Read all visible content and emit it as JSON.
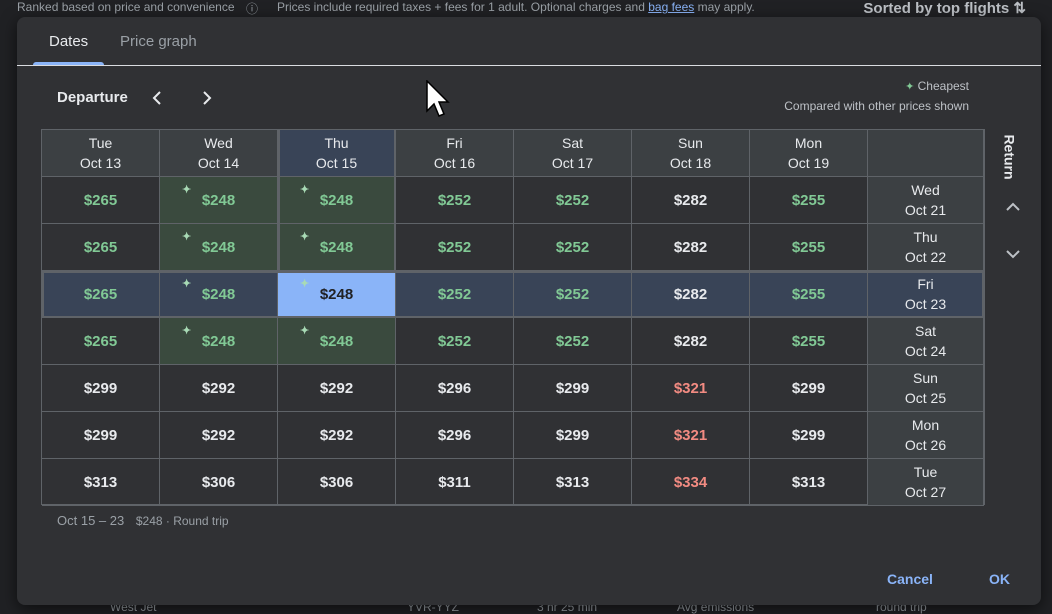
{
  "background": {
    "top_left": "Ranked based on price and convenience",
    "top_middle_prefix": "Prices include required taxes + fees for 1 adult. Optional charges and",
    "top_link": "bag fees",
    "top_middle_suffix": "may apply.",
    "top_right": "Sorted by top flights",
    "bottom_left": "West Jet",
    "bottom_mid": "YVR-YYZ",
    "bottom_mid2": "3 hr 25 min",
    "bottom_mid3": "Avg emissions",
    "bottom_right": "round trip"
  },
  "tabs": [
    {
      "label": "Dates",
      "active": true
    },
    {
      "label": "Price graph",
      "active": false
    }
  ],
  "departure_label": "Departure",
  "legend": {
    "cheapest": "Cheapest",
    "note": "Compared with other prices shown"
  },
  "return_label": "Return",
  "columns": [
    {
      "day": "Tue",
      "date": "Oct 13"
    },
    {
      "day": "Wed",
      "date": "Oct 14"
    },
    {
      "day": "Thu",
      "date": "Oct 15"
    },
    {
      "day": "Fri",
      "date": "Oct 16"
    },
    {
      "day": "Sat",
      "date": "Oct 17"
    },
    {
      "day": "Sun",
      "date": "Oct 18"
    },
    {
      "day": "Mon",
      "date": "Oct 19"
    }
  ],
  "rows": [
    {
      "day": "Wed",
      "date": "Oct 21",
      "prices": [
        "$265",
        "$248",
        "$248",
        "$252",
        "$252",
        "$282",
        "$255"
      ]
    },
    {
      "day": "Thu",
      "date": "Oct 22",
      "prices": [
        "$265",
        "$248",
        "$248",
        "$252",
        "$252",
        "$282",
        "$255"
      ]
    },
    {
      "day": "Fri",
      "date": "Oct 23",
      "prices": [
        "$265",
        "$248",
        "$248",
        "$252",
        "$252",
        "$282",
        "$255"
      ]
    },
    {
      "day": "Sat",
      "date": "Oct 24",
      "prices": [
        "$265",
        "$248",
        "$248",
        "$252",
        "$252",
        "$282",
        "$255"
      ]
    },
    {
      "day": "Sun",
      "date": "Oct 25",
      "prices": [
        "$299",
        "$292",
        "$292",
        "$296",
        "$299",
        "$321",
        "$299"
      ]
    },
    {
      "day": "Mon",
      "date": "Oct 26",
      "prices": [
        "$299",
        "$292",
        "$292",
        "$296",
        "$299",
        "$321",
        "$299"
      ]
    },
    {
      "day": "Tue",
      "date": "Oct 27",
      "prices": [
        "$313",
        "$306",
        "$306",
        "$311",
        "$313",
        "$334",
        "$313"
      ]
    }
  ],
  "price_status": [
    [
      "cheap",
      "cheap",
      "cheap",
      "cheap",
      "cheap",
      "normal",
      "cheap"
    ],
    [
      "cheap",
      "cheap",
      "cheap",
      "cheap",
      "cheap",
      "normal",
      "cheap"
    ],
    [
      "cheap",
      "cheap",
      "normal",
      "cheap",
      "cheap",
      "normal",
      "cheap"
    ],
    [
      "cheap",
      "cheap",
      "cheap",
      "cheap",
      "cheap",
      "normal",
      "cheap"
    ],
    [
      "normal",
      "normal",
      "normal",
      "normal",
      "normal",
      "high",
      "normal"
    ],
    [
      "normal",
      "normal",
      "normal",
      "normal",
      "normal",
      "high",
      "normal"
    ],
    [
      "normal",
      "normal",
      "normal",
      "normal",
      "normal",
      "high",
      "normal"
    ]
  ],
  "cheapest_marked": [
    [
      false,
      true,
      true,
      false,
      false,
      false,
      false
    ],
    [
      false,
      true,
      true,
      false,
      false,
      false,
      false
    ],
    [
      false,
      true,
      true,
      false,
      false,
      false,
      false
    ],
    [
      false,
      true,
      true,
      false,
      false,
      false,
      false
    ],
    [
      false,
      false,
      false,
      false,
      false,
      false,
      false
    ],
    [
      false,
      false,
      false,
      false,
      false,
      false,
      false
    ],
    [
      false,
      false,
      false,
      false,
      false,
      false,
      false
    ]
  ],
  "selected": {
    "col": 2,
    "row": 2
  },
  "summary": {
    "dates": "Oct 15 – 23",
    "price": "$248 · Round trip"
  },
  "buttons": {
    "cancel": "Cancel",
    "ok": "OK"
  },
  "colors": {
    "cheap": "#81c995",
    "high": "#f28b82",
    "accent": "#8ab4f8",
    "dialog_bg": "#303134"
  },
  "icons": {
    "prev": "chevron-left-icon",
    "next": "chevron-right-icon",
    "up": "chevron-up-icon",
    "down": "chevron-down-icon",
    "sparkle": "sparkle-icon",
    "sort": "sort-icon",
    "info": "info-icon"
  }
}
